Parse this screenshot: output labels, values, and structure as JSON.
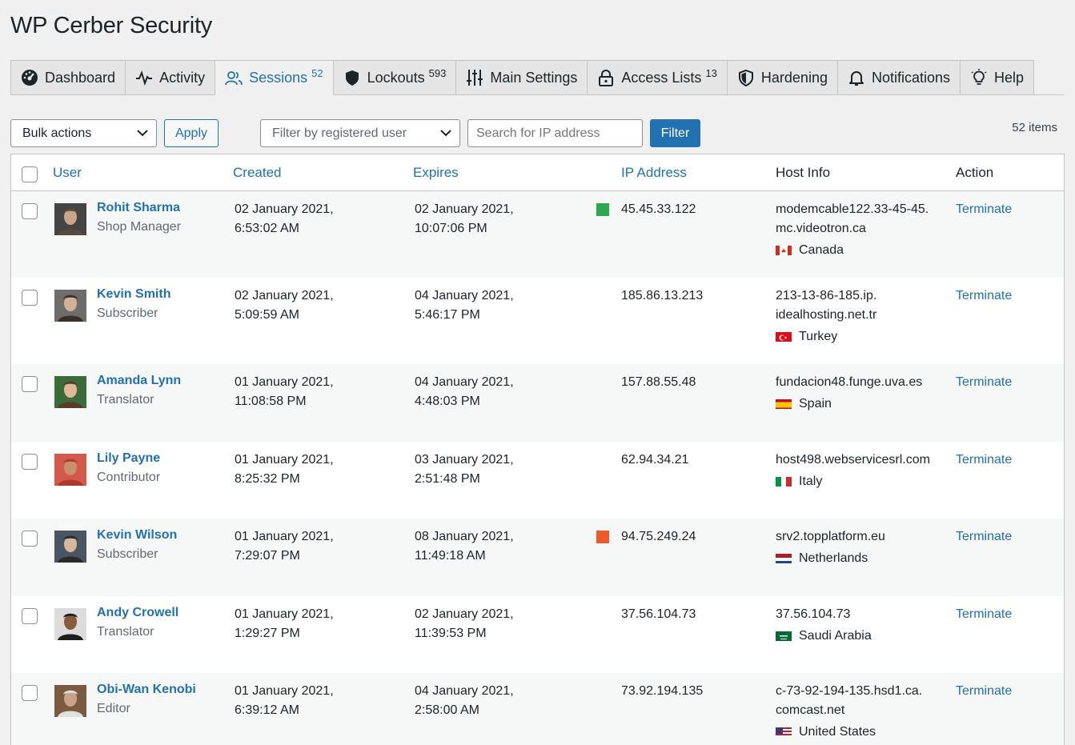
{
  "page_title": "WP Cerber Security",
  "tabs": [
    {
      "label": "Dashboard",
      "icon": "dashboard-icon",
      "badge": ""
    },
    {
      "label": "Activity",
      "icon": "activity-icon",
      "badge": ""
    },
    {
      "label": "Sessions",
      "icon": "users-icon",
      "badge": "52",
      "active": true
    },
    {
      "label": "Lockouts",
      "icon": "shield-icon",
      "badge": "593"
    },
    {
      "label": "Main Settings",
      "icon": "sliders-icon",
      "badge": ""
    },
    {
      "label": "Access Lists",
      "icon": "lock-icon",
      "badge": "13"
    },
    {
      "label": "Hardening",
      "icon": "shield-check-icon",
      "badge": ""
    },
    {
      "label": "Notifications",
      "icon": "bell-icon",
      "badge": ""
    },
    {
      "label": "Help",
      "icon": "lightbulb-icon",
      "badge": ""
    }
  ],
  "toolbar": {
    "bulk_actions": "Bulk actions",
    "apply": "Apply",
    "filter_user": "Filter by registered user",
    "search_placeholder": "Search for IP address",
    "filter": "Filter",
    "items_count": "52 items"
  },
  "columns": {
    "user": "User",
    "created": "Created",
    "expires": "Expires",
    "ip": "IP Address",
    "host": "Host Info",
    "action": "Action"
  },
  "colors": {
    "accent": "#2271b1",
    "ip_green": "#2ea84f",
    "ip_red": "#f05a28"
  },
  "rows": [
    {
      "name": "Rohit Sharma",
      "role": "Shop Manager",
      "created1": "02 January 2021,",
      "created2": "6:53:02 AM",
      "expires1": "02 January 2021,",
      "expires2": "10:07:06 PM",
      "ip": "45.45.33.122",
      "ip_status": "green",
      "host1": "modemcable122.33-45-45.",
      "host2": "mc.videotron.ca",
      "country": "Canada",
      "flag": "ca",
      "action": "Terminate"
    },
    {
      "name": "Kevin Smith",
      "role": "Subscriber",
      "created1": "02 January 2021,",
      "created2": "5:09:59 AM",
      "expires1": "04 January 2021,",
      "expires2": "5:46:17 PM",
      "ip": "185.86.13.213",
      "ip_status": "",
      "host1": "213-13-86-185.ip.",
      "host2": "idealhosting.net.tr",
      "country": "Turkey",
      "flag": "tr",
      "action": "Terminate"
    },
    {
      "name": "Amanda Lynn",
      "role": "Translator",
      "created1": "01 January 2021,",
      "created2": "11:08:58 PM",
      "expires1": "04 January 2021,",
      "expires2": "4:48:03 PM",
      "ip": "157.88.55.48",
      "ip_status": "",
      "host1": "fundacion48.funge.uva.es",
      "host2": "",
      "country": "Spain",
      "flag": "es",
      "action": "Terminate"
    },
    {
      "name": "Lily Payne",
      "role": "Contributor",
      "created1": "01 January 2021,",
      "created2": "8:25:32 PM",
      "expires1": "03 January 2021,",
      "expires2": "2:51:48 PM",
      "ip": "62.94.34.21",
      "ip_status": "",
      "host1": "host498.webservicesrl.com",
      "host2": "",
      "country": "Italy",
      "flag": "it",
      "action": "Terminate"
    },
    {
      "name": "Kevin Wilson",
      "role": "Subscriber",
      "created1": "01 January 2021,",
      "created2": "7:29:07 PM",
      "expires1": "08 January 2021,",
      "expires2": "11:49:18 AM",
      "ip": "94.75.249.24",
      "ip_status": "red",
      "host1": "srv2.topplatform.eu",
      "host2": "",
      "country": "Netherlands",
      "flag": "nl",
      "action": "Terminate"
    },
    {
      "name": "Andy Crowell",
      "role": "Translator",
      "created1": "01 January 2021,",
      "created2": "1:29:27 PM",
      "expires1": "02 January 2021,",
      "expires2": "11:39:53 PM",
      "ip": "37.56.104.73",
      "ip_status": "",
      "host1": "37.56.104.73",
      "host2": "",
      "country": "Saudi Arabia",
      "flag": "sa",
      "action": "Terminate"
    },
    {
      "name": "Obi-Wan Kenobi",
      "role": "Editor",
      "created1": "01 January 2021,",
      "created2": "6:39:12 AM",
      "expires1": "04 January 2021,",
      "expires2": "2:58:00 AM",
      "ip": "73.92.194.135",
      "ip_status": "",
      "host1": "c-73-92-194-135.hsd1.ca.",
      "host2": "comcast.net",
      "country": "United States",
      "flag": "us",
      "action": "Terminate"
    }
  ]
}
